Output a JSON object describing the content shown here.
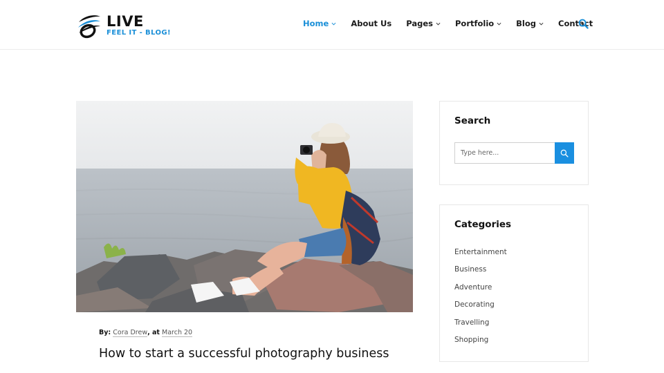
{
  "brand": {
    "title": "LIVE",
    "tagline": "FEEL IT - BLOG!"
  },
  "nav": [
    {
      "label": "Home",
      "dropdown": true,
      "active": true
    },
    {
      "label": "About Us",
      "dropdown": false
    },
    {
      "label": "Pages",
      "dropdown": true
    },
    {
      "label": "Portfolio",
      "dropdown": true
    },
    {
      "label": "Blog",
      "dropdown": true
    },
    {
      "label": "Contact",
      "dropdown": false
    }
  ],
  "post": {
    "by_label": "By:",
    "author": "Cora Drew",
    "at_label": ", at",
    "date": "March 20",
    "title": "How to start a successful photography business"
  },
  "sidebar": {
    "search": {
      "title": "Search",
      "placeholder": "Type here..."
    },
    "categories": {
      "title": "Categories",
      "items": [
        "Entertainment",
        "Business",
        "Adventure",
        "Decorating",
        "Travelling",
        "Shopping"
      ]
    }
  },
  "colors": {
    "accent": "#1a8fd8",
    "button": "#1a8fe0",
    "text": "#111111"
  }
}
